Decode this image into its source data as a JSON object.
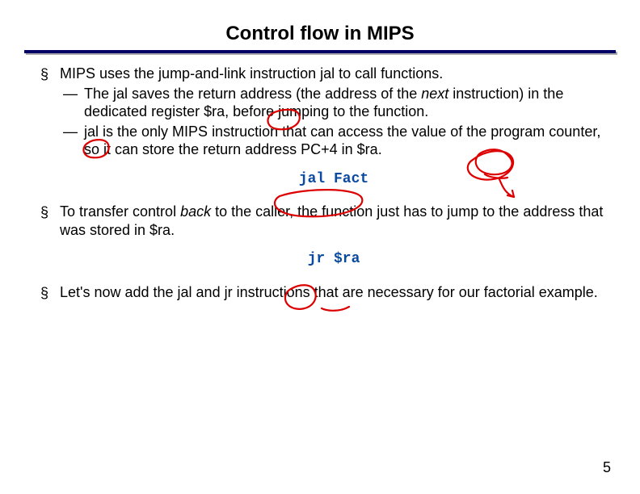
{
  "title": "Control flow in MIPS",
  "bullets": {
    "b1_prefix": "MIPS uses the jump-and-link instruction ",
    "b1_jal": "jal",
    "b1_suffix": " to call functions.",
    "b1a_prefix": "The jal saves the return address (the address of the ",
    "b1a_next": "next",
    "b1a_mid": " instruction) in the dedicated register ",
    "b1a_ra": "$ra,",
    "b1a_suffix": " before jumping to the function.",
    "b1b": "jal is the only MIPS instruction that can access the value of the program counter, so it can store the return address PC+4 in $ra.",
    "code1": "jal Fact",
    "b2_prefix": "To transfer control ",
    "b2_back": "back",
    "b2_suffix": " to the caller, the function just has to jump to the address that was stored in $ra.",
    "code2": "jr $ra",
    "b3": "Let's now add the jal and jr instructions that are necessary for our factorial example."
  },
  "page_number": "5"
}
